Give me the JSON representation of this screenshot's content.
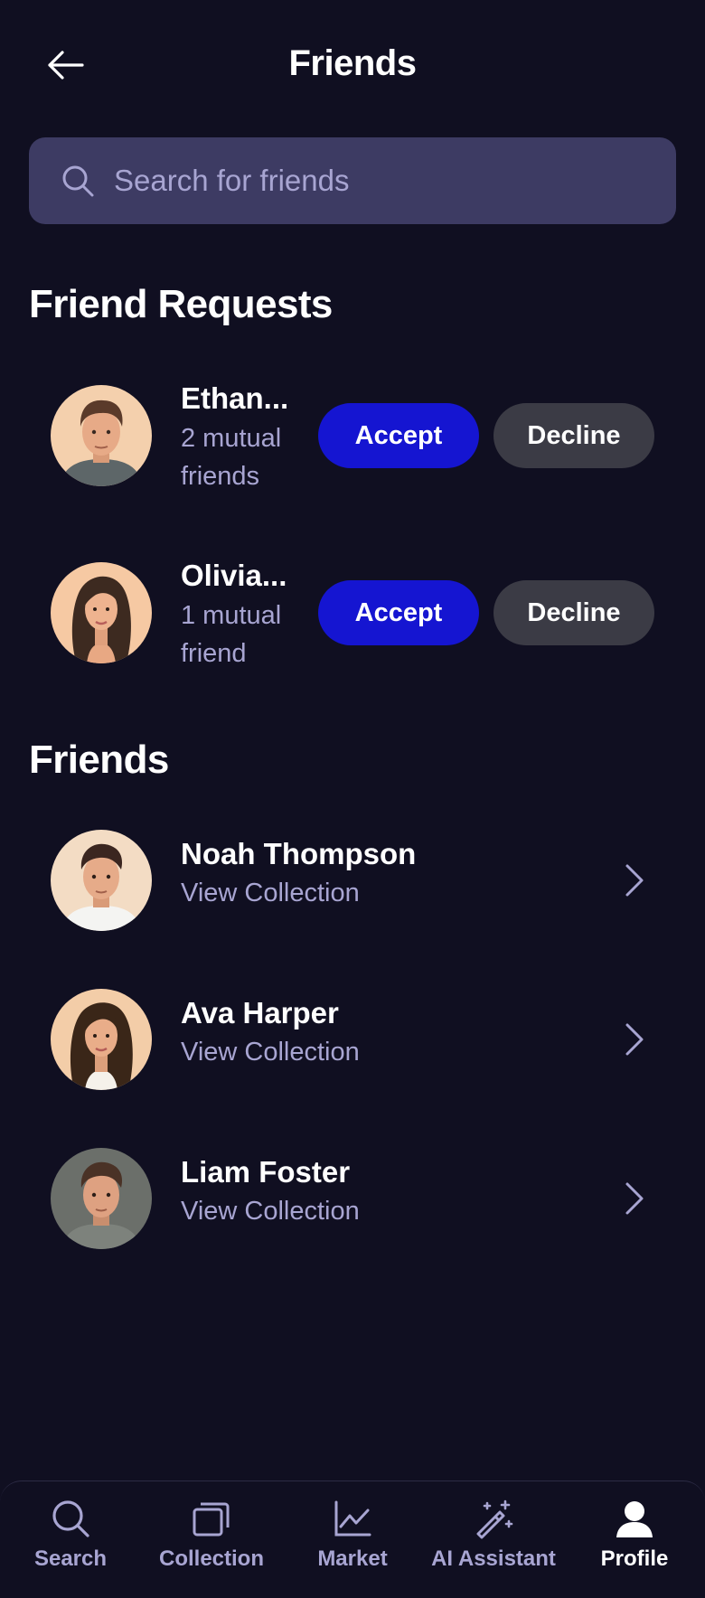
{
  "header": {
    "title": "Friends",
    "back_icon": "arrow-left-icon"
  },
  "search": {
    "placeholder": "Search for friends",
    "value": "",
    "icon": "search-icon"
  },
  "requests": {
    "title": "Friend Requests",
    "items": [
      {
        "name": "Ethan...",
        "mutual": "2 mutual friends",
        "accept_label": "Accept",
        "decline_label": "Decline"
      },
      {
        "name": "Olivia...",
        "mutual": "1 mutual friend",
        "accept_label": "Accept",
        "decline_label": "Decline"
      }
    ]
  },
  "friends": {
    "title": "Friends",
    "items": [
      {
        "name": "Noah Thompson",
        "subtitle": "View Collection"
      },
      {
        "name": "Ava Harper",
        "subtitle": "View Collection"
      },
      {
        "name": "Liam Foster",
        "subtitle": "View Collection"
      }
    ]
  },
  "nav": {
    "items": [
      {
        "label": "Search",
        "icon": "search-icon"
      },
      {
        "label": "Collection",
        "icon": "collection-icon"
      },
      {
        "label": "Market",
        "icon": "chart-line-icon"
      },
      {
        "label": "AI Assistant",
        "icon": "magic-wand-icon"
      },
      {
        "label": "Profile",
        "icon": "user-icon"
      }
    ],
    "active": "Profile"
  },
  "colors": {
    "background": "#100f21",
    "search_bg": "#3d3b63",
    "accent": "#1515d1",
    "decline_bg": "#3b3b45",
    "muted_text": "#a8a5d2"
  }
}
